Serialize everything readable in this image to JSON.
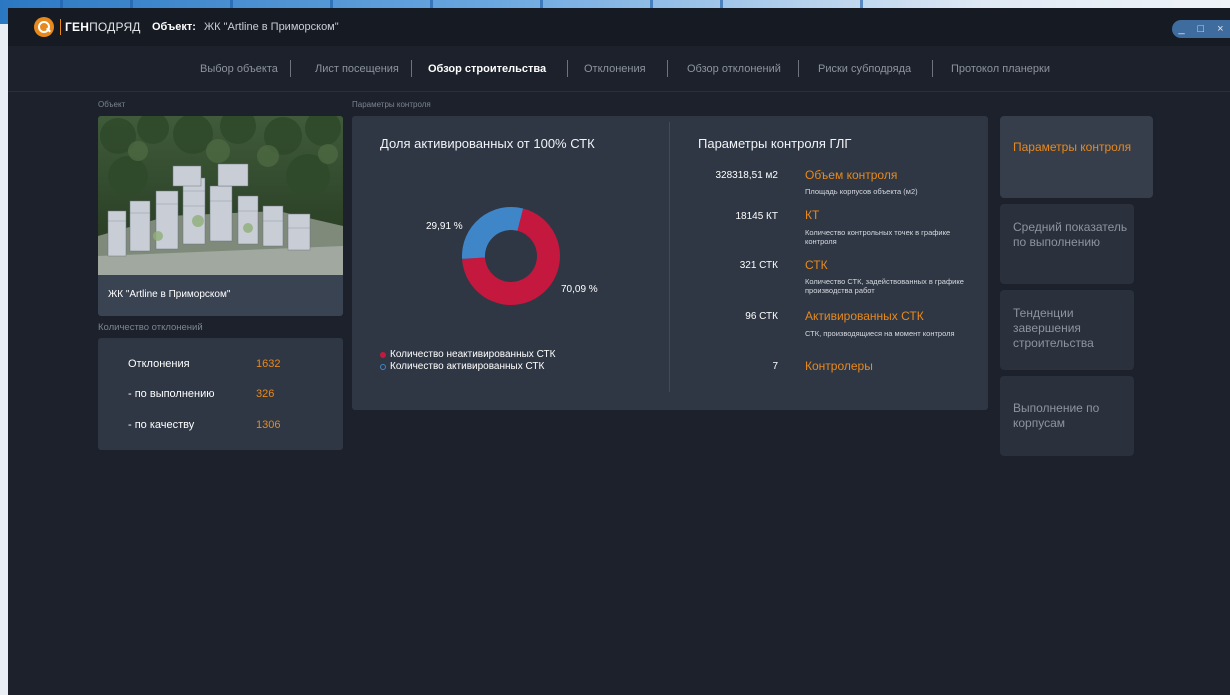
{
  "brand": {
    "name_bold": "ГЕН",
    "name_rest": "ПОДРЯД"
  },
  "header": {
    "object_label": "Объект:",
    "object_value": "ЖК \"Artline в Приморском\""
  },
  "window_controls": {
    "minimize": "_",
    "maximize": "□",
    "close": "×"
  },
  "nav": {
    "tabs": [
      {
        "label": "Выбор объекта"
      },
      {
        "label": "Лист посещения"
      },
      {
        "label": "Обзор строительства"
      },
      {
        "label": "Отклонения"
      },
      {
        "label": "Обзор отклонений"
      },
      {
        "label": "Риски субподряда"
      },
      {
        "label": "Протокол планерки"
      }
    ],
    "active_index": 2
  },
  "object_section": {
    "label": "Объект",
    "caption": "ЖК \"Artline в Приморском\""
  },
  "deviations": {
    "label": "Количество отклонений",
    "rows": [
      {
        "name": "Отклонения",
        "value": "1632"
      },
      {
        "name": "- по выполнению",
        "value": "326"
      },
      {
        "name": "- по качеству",
        "value": "1306"
      }
    ]
  },
  "params_section": {
    "label": "Параметры контроля"
  },
  "donut_panel": {
    "title": "Доля активированных от 100% СТК",
    "legend": [
      {
        "label": "Количество неактивированных СТК",
        "color": "#c4183f"
      },
      {
        "label": "Количество активированных СТК",
        "color": "#3f86c9"
      }
    ]
  },
  "chart_data": {
    "type": "pie",
    "title": "Доля активированных от 100% СТК",
    "categories": [
      "Количество неактивированных СТК",
      "Количество активированных СТК"
    ],
    "values": [
      70.09,
      29.91
    ],
    "labels": [
      "70,09 %",
      "29,91 %"
    ],
    "colors": [
      "#c4183f",
      "#3f86c9"
    ]
  },
  "glg_panel": {
    "title": "Параметры контроля ГЛГ",
    "items": [
      {
        "value": "328318,51 м2",
        "name": "Объем контроля",
        "desc": "Площадь корпусов объекта (м2)"
      },
      {
        "value": "18145 КТ",
        "name": "КТ",
        "desc": "Количество контрольных точек в графике контроля"
      },
      {
        "value": "321 СТК",
        "name": "СТК",
        "desc": "Количество СТК, задействованных в графике производства работ"
      },
      {
        "value": "96 СТК",
        "name": "Активированных СТК",
        "desc": "СТК, производящиеся на момент контроля"
      },
      {
        "value": "7",
        "name": "Контролеры",
        "desc": ""
      }
    ]
  },
  "side_menu": {
    "items": [
      {
        "label": "Параметры контроля"
      },
      {
        "label": "Средний показатель по выполнению"
      },
      {
        "label": "Тенденции завершения строительства"
      },
      {
        "label": "Выполнение по корпусам"
      }
    ],
    "active_index": 0
  },
  "colors": {
    "accent": "#e8891d",
    "background": "#1c212b",
    "panel": "#2f3744"
  }
}
